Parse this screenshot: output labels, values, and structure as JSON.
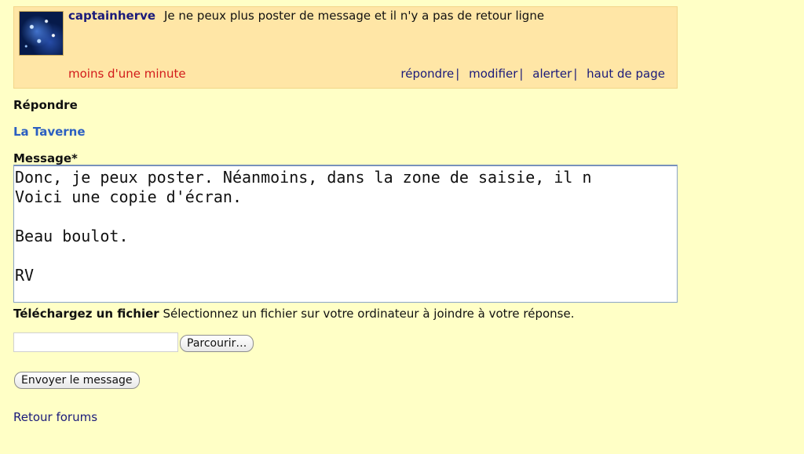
{
  "post": {
    "author": "captainherve",
    "subject": "Je ne peux plus poster de message et il n'y a pas de retour ligne",
    "timestamp": "moins d'une minute",
    "actions": [
      "répondre",
      "modifier",
      "alerter",
      "haut de page"
    ]
  },
  "reply": {
    "heading": "Répondre",
    "forum": "La Taverne",
    "message_label": "Message*",
    "message_text": "Donc, je peux poster. Néanmoins, dans la zone de saisie, il n\nVoici une copie d'écran.\n\nBeau boulot.\n\nRV",
    "upload_title": "Téléchargez un fichier",
    "upload_desc": "Sélectionnez un fichier sur votre ordinateur à joindre à votre réponse.",
    "file_value": "",
    "browse_label": "Parcourir…",
    "send_label": "Envoyer le message"
  },
  "footer": {
    "back_link": "Retour forums"
  },
  "colors": {
    "page_bg": "#ffffc6",
    "post_bg": "#ffe6a6",
    "author": "#1a1a7a",
    "timestamp": "#d21b1b",
    "forum_link": "#2b5fc1"
  },
  "icons": {
    "avatar": "galaxy-avatar"
  }
}
